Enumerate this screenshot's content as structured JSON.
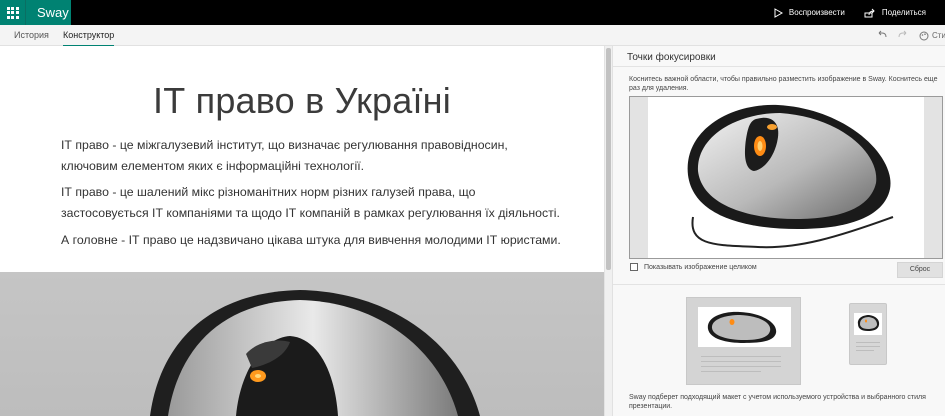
{
  "topbar": {
    "app_name": "Sway",
    "play_label": "Воспроизвести",
    "share_label": "Поделиться",
    "accent_color": "#008272"
  },
  "tabs": {
    "history_label": "История",
    "designer_label": "Конструктор",
    "styles_label": "Сти"
  },
  "document": {
    "title": "ІТ право в Україні",
    "paragraphs": [
      "ІТ право - це міжгалузевий інститут, що визначає регулювання правовідносин, ключовим елементом яких є інформаційні технології.",
      "ІТ право - це шалений мікс різноманітних норм різних галузей права, що застосовується ІТ компаніями та щодо ІТ компаній в рамках регулювання їх діяльності.",
      "А головне - ІТ право це надзвичано цікава штука для вивчення молодими ІТ юристами."
    ]
  },
  "pane": {
    "title": "Точки фокусировки",
    "hint": "Коснитесь важной области, чтобы правильно разместить изображение в Sway. Коснитесь еще раз для удаления.",
    "checkbox_label": "Показывать изображение целиком",
    "reset_label": "Сброс",
    "footer": "Sway подберет подходящий макет с учетом используемого устройства и выбранного стиля презентации."
  },
  "icons": [
    "app-launcher-icon",
    "play-icon",
    "share-icon",
    "undo-icon",
    "redo-icon",
    "styles-icon"
  ]
}
